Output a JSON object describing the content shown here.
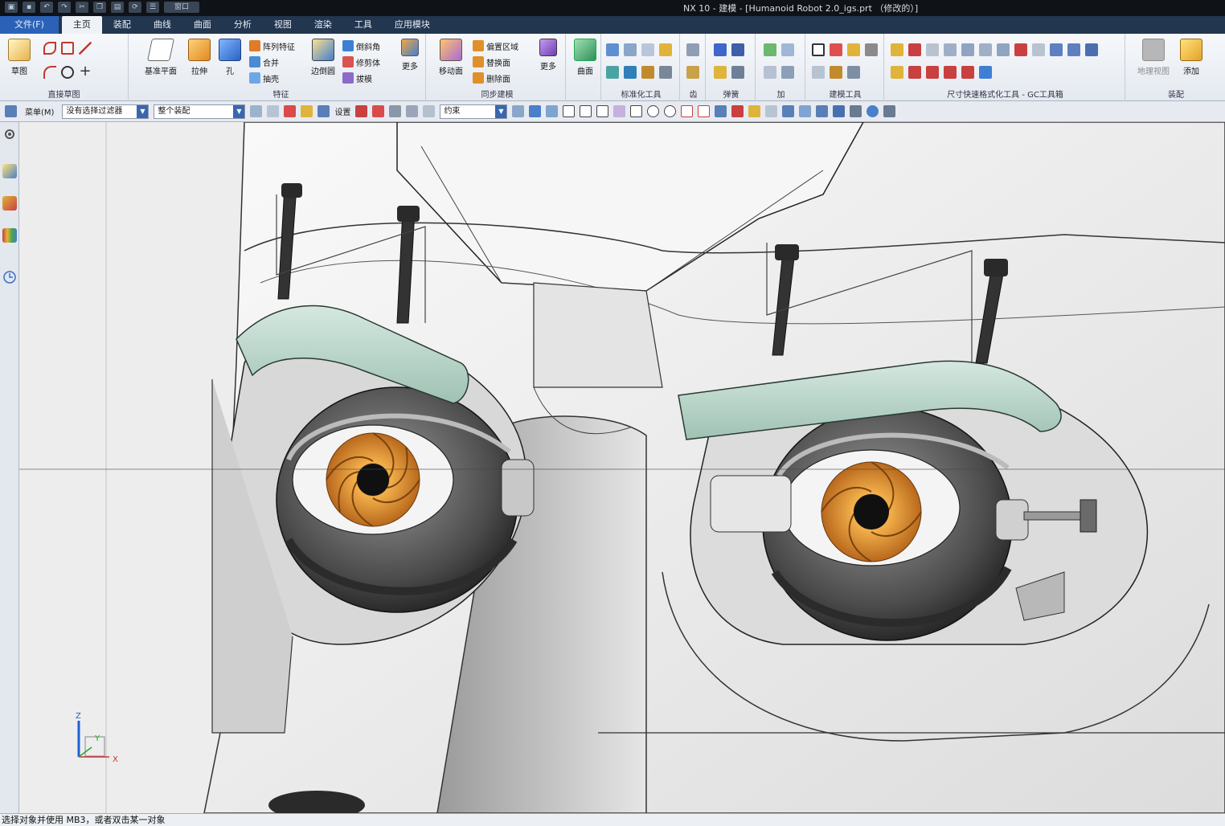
{
  "window": {
    "title": "NX 10 - 建模 - [Humanoid Robot 2.0_igs.prt （修改的）]",
    "quick_access_window_label": "窗口"
  },
  "tabs": [
    {
      "label": "文件(F)",
      "kind": "file"
    },
    {
      "label": "主页",
      "kind": "active"
    },
    {
      "label": "装配",
      "kind": ""
    },
    {
      "label": "曲线",
      "kind": ""
    },
    {
      "label": "曲面",
      "kind": ""
    },
    {
      "label": "分析",
      "kind": ""
    },
    {
      "label": "视图",
      "kind": ""
    },
    {
      "label": "渲染",
      "kind": ""
    },
    {
      "label": "工具",
      "kind": ""
    },
    {
      "label": "应用模块",
      "kind": ""
    }
  ],
  "ribbon": {
    "sketch": {
      "btn": "草图",
      "group": "直接草图"
    },
    "feature": {
      "datum_plane": "基准平面",
      "extrude": "拉伸",
      "hole": "孔",
      "pattern_feature": "阵列特征",
      "unite": "合并",
      "shell": "抽壳",
      "edge_blend": "边倒圆",
      "chamfer": "倒斜角",
      "trim_body": "修剪体",
      "draft": "拔模",
      "more": "更多",
      "group": "特征"
    },
    "sync": {
      "move_face": "移动面",
      "offset_region": "偏置区域",
      "replace_face": "替换面",
      "delete_face": "删除面",
      "more": "更多",
      "group": "同步建模"
    },
    "surface": {
      "btn": "曲面"
    },
    "standard_tools": {
      "group": "标准化工具"
    },
    "gear": {
      "group": "齿"
    },
    "spring": {
      "group": "弹簧"
    },
    "add_on": {
      "group": "加"
    },
    "modeling_tools": {
      "group": "建模工具"
    },
    "dimension_tools": {
      "group": "尺寸快速格式化工具 - GC工具箱"
    },
    "assembly": {
      "view_btn": "地理视图",
      "add_btn": "添加",
      "group": "装配"
    }
  },
  "selection_bar": {
    "menu_label": "菜单(M)",
    "filter_value": "没有选择过滤器",
    "scope_value": "整个装配",
    "snap_label": "设置",
    "constraint_value": "约束"
  },
  "triad": {
    "x": "X",
    "y": "Y",
    "z": "Z"
  },
  "status": {
    "message": "选择对象并使用 MB3，或者双击某一对象"
  },
  "colors": {
    "accent": "#2b62b8",
    "tab_bar": "#22364f",
    "eyebrow": "#bcd6cc",
    "iris": "#e8a33a",
    "eyeball_shell": "#5b5b5b"
  }
}
